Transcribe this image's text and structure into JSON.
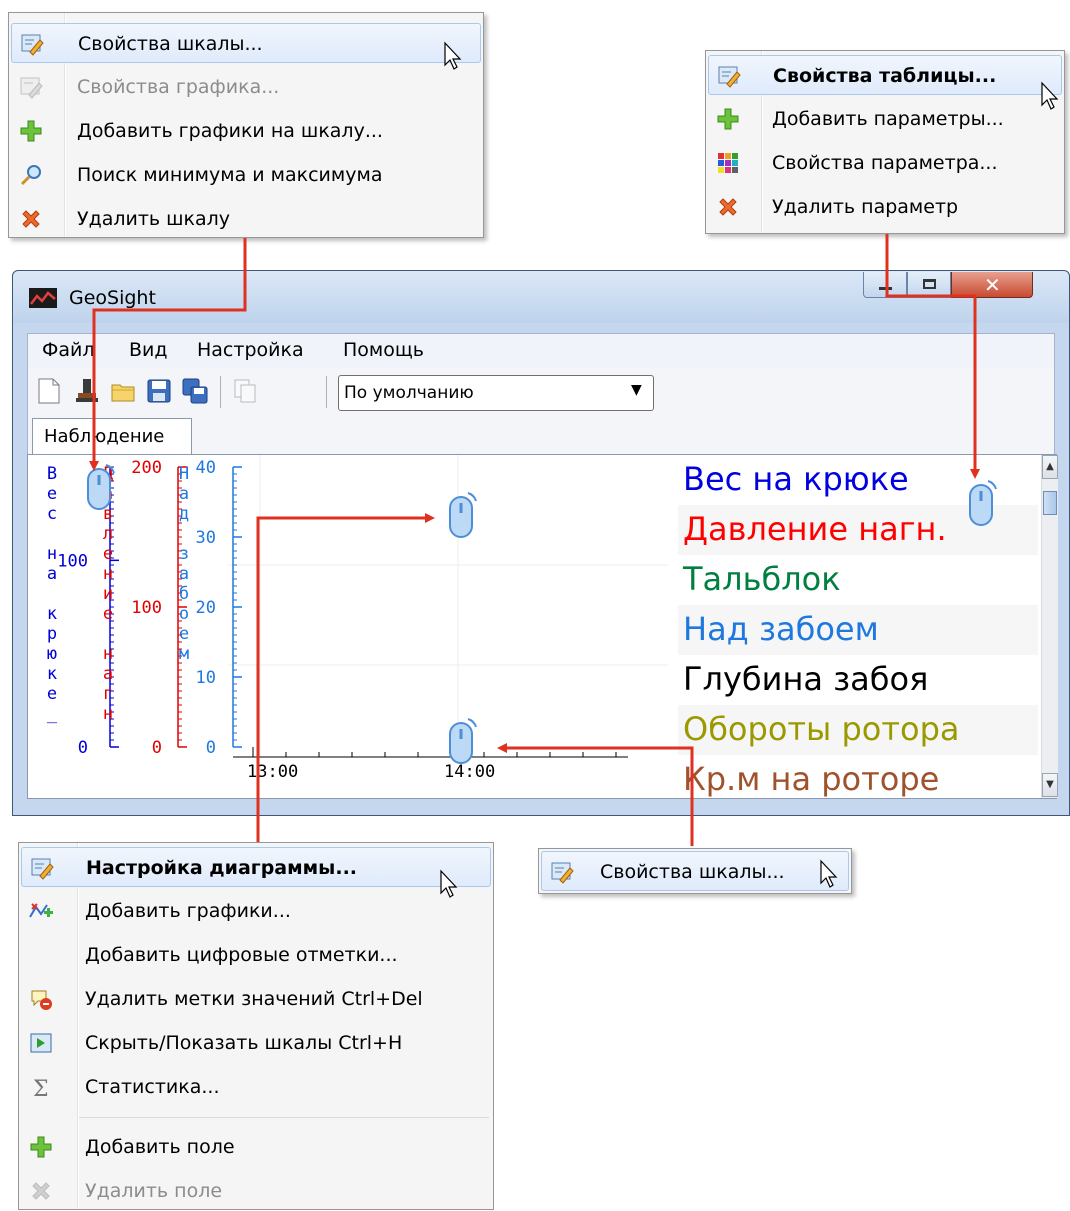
{
  "menu_scale": {
    "items": [
      {
        "label": "Свойства шкалы...",
        "icon": "properties-icon",
        "state": "highlighted"
      },
      {
        "label": "Свойства графика...",
        "icon": "properties-icon",
        "state": "disabled"
      },
      {
        "label": "Добавить графики на шкалу...",
        "icon": "plus-icon",
        "state": "normal"
      },
      {
        "label": "Поиск минимума и максимума",
        "icon": "search-icon",
        "state": "normal"
      },
      {
        "label": "Удалить шкалу",
        "icon": "delete-x-icon",
        "state": "normal"
      }
    ]
  },
  "menu_table": {
    "items": [
      {
        "label": "Свойства таблицы...",
        "icon": "properties-icon",
        "state": "highlighted"
      },
      {
        "label": "Добавить параметры...",
        "icon": "plus-icon",
        "state": "normal"
      },
      {
        "label": "Свойства параметра...",
        "icon": "color-grid-icon",
        "state": "normal"
      },
      {
        "label": "Удалить параметр",
        "icon": "delete-x-icon",
        "state": "normal"
      }
    ]
  },
  "window": {
    "title": "GeoSight",
    "menubar": [
      "Файл",
      "Вид",
      "Настройка",
      "Помощь"
    ],
    "toolbar": {
      "icons": [
        "new-file-icon",
        "stamp-icon",
        "open-folder-icon",
        "save-icon",
        "save-all-icon",
        "copy-icon"
      ],
      "combo_value": "По умолчанию"
    },
    "tab": "Наблюдение",
    "scales": [
      {
        "vertical_label": [
          "В",
          "е",
          "с",
          "",
          "н",
          "а",
          "",
          "к",
          "р",
          "ю",
          "к",
          "е",
          "_"
        ],
        "color": "#0000d8",
        "ticks": [
          "100",
          "0"
        ]
      },
      {
        "vertical_label": [
          "Д",
          "а",
          "в",
          "л",
          "е",
          "н",
          "и",
          "е",
          "",
          "н",
          "а",
          "г",
          "н"
        ],
        "color": "#e00000",
        "ticks": [
          "200",
          "100",
          "0"
        ]
      },
      {
        "vertical_label": [
          "Н",
          "а",
          "д",
          "",
          "з",
          "а",
          "б",
          "о",
          "е",
          "м"
        ],
        "color": "#1f78e0",
        "ticks": [
          "40",
          "30",
          "20",
          "10",
          "0"
        ]
      }
    ],
    "time_axis": [
      "13:00",
      "14:00"
    ],
    "legend": [
      {
        "label": "Вес на крюке",
        "color": "#0000e0"
      },
      {
        "label": "Давление нагн.",
        "color": "#ff0000"
      },
      {
        "label": "Тальблок",
        "color": "#008040"
      },
      {
        "label": "Над забоем",
        "color": "#1f78e0"
      },
      {
        "label": "Глубина забоя",
        "color": "#000000"
      },
      {
        "label": "Обороты ротора",
        "color": "#9a9a00"
      },
      {
        "label": "Кр.м на роторе",
        "color": "#a0522d"
      }
    ]
  },
  "menu_chart": {
    "items": [
      {
        "label": "Настройка диаграммы...",
        "icon": "properties-icon",
        "state": "highlighted"
      },
      {
        "label": "Добавить графики...",
        "icon": "add-graph-icon",
        "state": "normal"
      },
      {
        "label": "Добавить цифровые отметки...",
        "icon": "",
        "state": "normal"
      },
      {
        "label": "Удалить метки значений Ctrl+Del",
        "icon": "delete-labels-icon",
        "state": "normal"
      },
      {
        "label": "Скрыть/Показать шкалы   Ctrl+H",
        "icon": "toggle-scales-icon",
        "state": "normal"
      },
      {
        "label": "Статистика...",
        "icon": "sigma-icon",
        "state": "normal"
      },
      {
        "label": "Добавить поле",
        "icon": "plus-icon",
        "state": "normal"
      },
      {
        "label": "Удалить поле",
        "icon": "delete-x-icon",
        "state": "disabled"
      }
    ]
  },
  "menu_scale_short": {
    "label": "Свойства шкалы...",
    "icon": "properties-icon"
  }
}
